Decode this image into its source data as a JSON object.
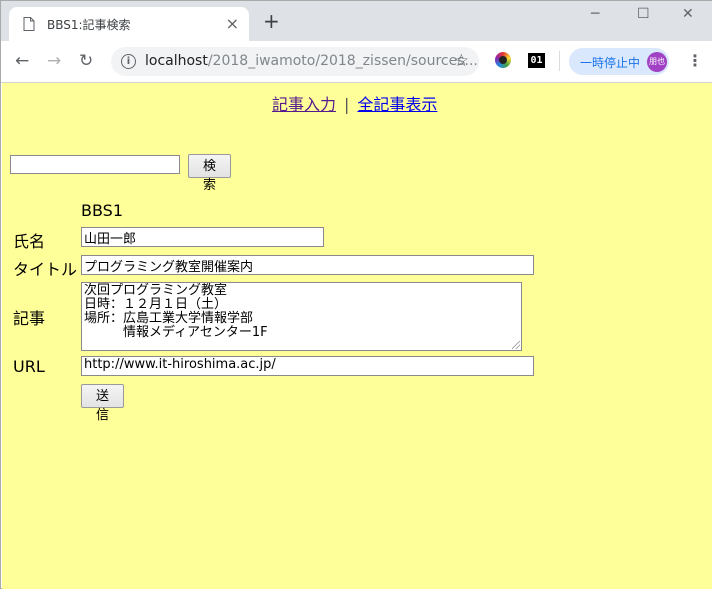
{
  "browser": {
    "tab_title": "BBS1:記事検索",
    "new_tab": "+",
    "window_controls": {
      "minimize": "─",
      "maximize": "☐",
      "close": "✕"
    },
    "url_host": "localhost",
    "url_path": "/2018_iwamoto/2018_zissen/sources...",
    "extension_badge": "01",
    "pause_label": "一時停止中",
    "avatar_text": "朋也"
  },
  "page": {
    "nav": {
      "post_link": "記事入力",
      "separator": "|",
      "all_link": "全記事表示"
    },
    "search": {
      "value": "",
      "button": "検索"
    },
    "form_heading": "BBS1",
    "labels": {
      "name": "氏名",
      "title": "タイトル",
      "article": "記事",
      "url": "URL"
    },
    "values": {
      "name": "山田一郎",
      "title": "プログラミング教室開催案内",
      "article": "次回プログラミング教室\n日時：１２月１日（土）\n場所：広島工業大学情報学部\n　　　情報メディアセンター1F",
      "url": "http://www.it-hiroshima.ac.jp/"
    },
    "submit": "送信"
  },
  "colors": {
    "page_background": "#ffff99",
    "link": "#0000ee",
    "visited_link": "#551a8b"
  }
}
